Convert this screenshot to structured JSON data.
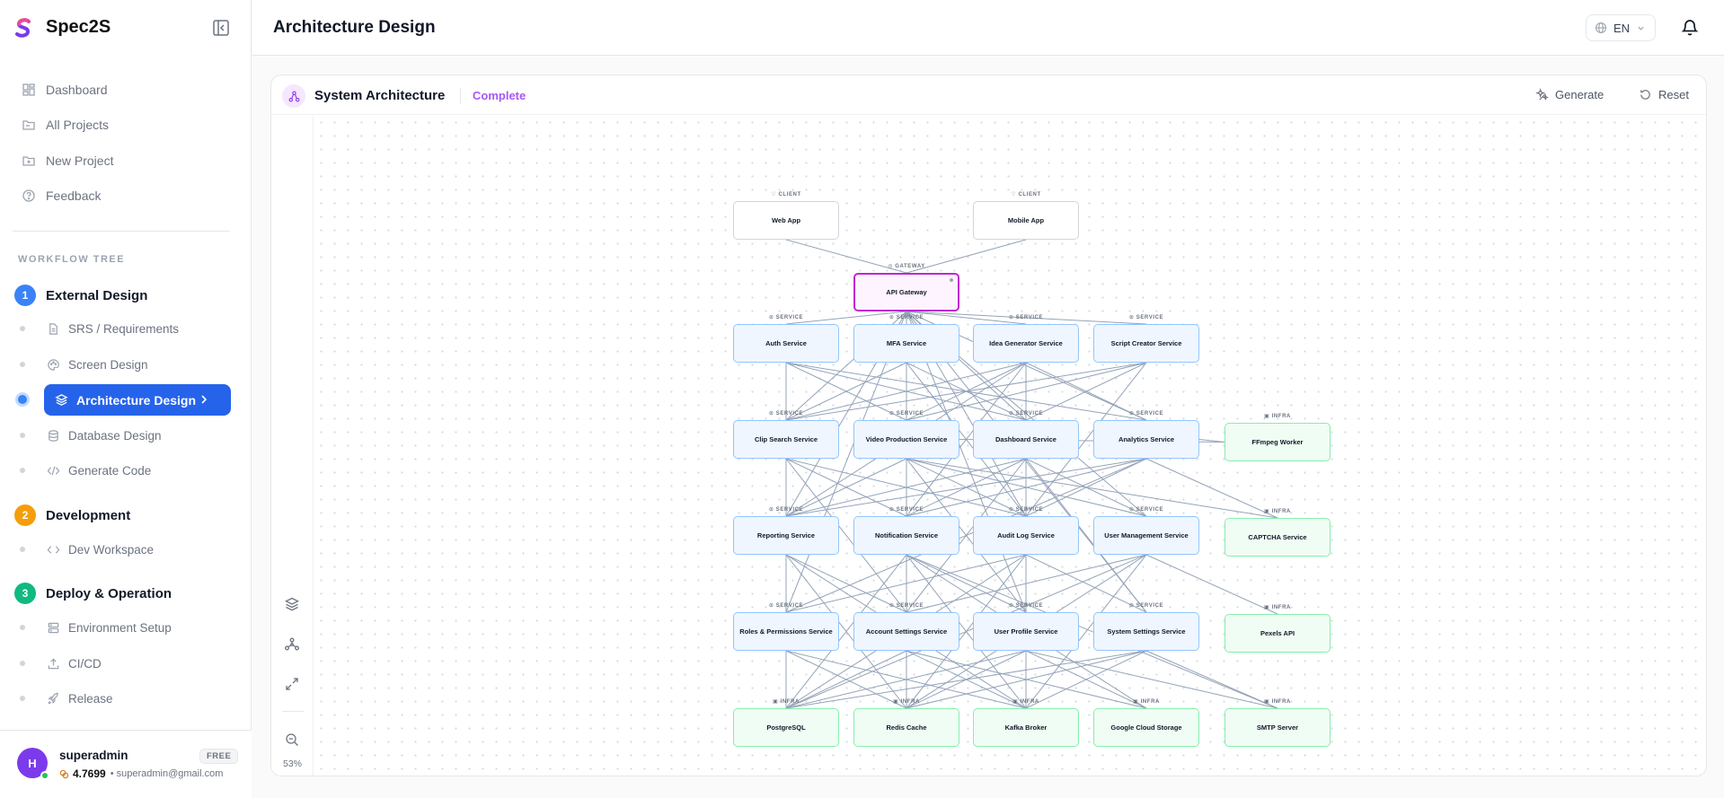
{
  "app": {
    "name": "Spec2S"
  },
  "nav": [
    {
      "label": "Dashboard",
      "icon": "dashboard-icon"
    },
    {
      "label": "All Projects",
      "icon": "folder-icon"
    },
    {
      "label": "New Project",
      "icon": "folder-plus-icon"
    },
    {
      "label": "Feedback",
      "icon": "help-circle-icon"
    }
  ],
  "workflow": {
    "title": "WORKFLOW TREE",
    "phases": [
      {
        "num": "1",
        "label": "External Design",
        "color": "#3b82f6",
        "items": [
          "SRS / Requirements",
          "Screen Design",
          "Architecture Design",
          "Database Design",
          "Generate Code"
        ]
      },
      {
        "num": "2",
        "label": "Development",
        "color": "#f59e0b",
        "items": [
          "Dev Workspace"
        ]
      },
      {
        "num": "3",
        "label": "Deploy & Operation",
        "color": "#10b981",
        "items": [
          "Environment Setup",
          "CI/CD",
          "Release"
        ]
      }
    ],
    "active_item": "Architecture Design"
  },
  "user": {
    "name": "superadmin",
    "plan": "FREE",
    "credits": "4.7699",
    "email": "superadmin@gmail.com",
    "initial": "H"
  },
  "header": {
    "title": "Architecture Design",
    "lang": "EN"
  },
  "panel": {
    "title": "System Architecture",
    "status": "Complete",
    "generate_label": "Generate",
    "reset_label": "Reset",
    "zoom": "53%"
  },
  "diagram": {
    "tags": {
      "client": "CLIENT",
      "gateway": "GATEWAY",
      "service": "SERVICE",
      "infra": "INFRA"
    },
    "nodes": [
      {
        "id": "web",
        "label": "Web App",
        "type": "client"
      },
      {
        "id": "mobile",
        "label": "Mobile App",
        "type": "client"
      },
      {
        "id": "gw",
        "label": "API Gateway",
        "type": "gateway"
      },
      {
        "id": "auth",
        "label": "Auth Service",
        "type": "service"
      },
      {
        "id": "mfa",
        "label": "MFA Service",
        "type": "service"
      },
      {
        "id": "idea",
        "label": "Idea Generator Service",
        "type": "service"
      },
      {
        "id": "script",
        "label": "Script Creator Service",
        "type": "service"
      },
      {
        "id": "clip",
        "label": "Clip Search Service",
        "type": "service"
      },
      {
        "id": "video",
        "label": "Video Production Service",
        "type": "service"
      },
      {
        "id": "dash",
        "label": "Dashboard Service",
        "type": "service"
      },
      {
        "id": "analytics",
        "label": "Analytics Service",
        "type": "service"
      },
      {
        "id": "ffmpeg",
        "label": "FFmpeg Worker",
        "type": "infra"
      },
      {
        "id": "report",
        "label": "Reporting Service",
        "type": "service"
      },
      {
        "id": "notif",
        "label": "Notification Service",
        "type": "service"
      },
      {
        "id": "audit",
        "label": "Audit Log Service",
        "type": "service"
      },
      {
        "id": "usermgmt",
        "label": "User Management Service",
        "type": "service"
      },
      {
        "id": "captcha",
        "label": "CAPTCHA Service",
        "type": "infra"
      },
      {
        "id": "roles",
        "label": "Roles & Permissions Service",
        "type": "service"
      },
      {
        "id": "account",
        "label": "Account Settings Service",
        "type": "service"
      },
      {
        "id": "profile",
        "label": "User Profile Service",
        "type": "service"
      },
      {
        "id": "sysset",
        "label": "System Settings Service",
        "type": "service"
      },
      {
        "id": "pexels",
        "label": "Pexels API",
        "type": "infra"
      },
      {
        "id": "pg",
        "label": "PostgreSQL",
        "type": "infra"
      },
      {
        "id": "redis",
        "label": "Redis Cache",
        "type": "infra"
      },
      {
        "id": "kafka",
        "label": "Kafka Broker",
        "type": "infra"
      },
      {
        "id": "gcs",
        "label": "Google Cloud Storage",
        "type": "infra"
      },
      {
        "id": "smtp",
        "label": "SMTP Server",
        "type": "infra"
      }
    ]
  }
}
